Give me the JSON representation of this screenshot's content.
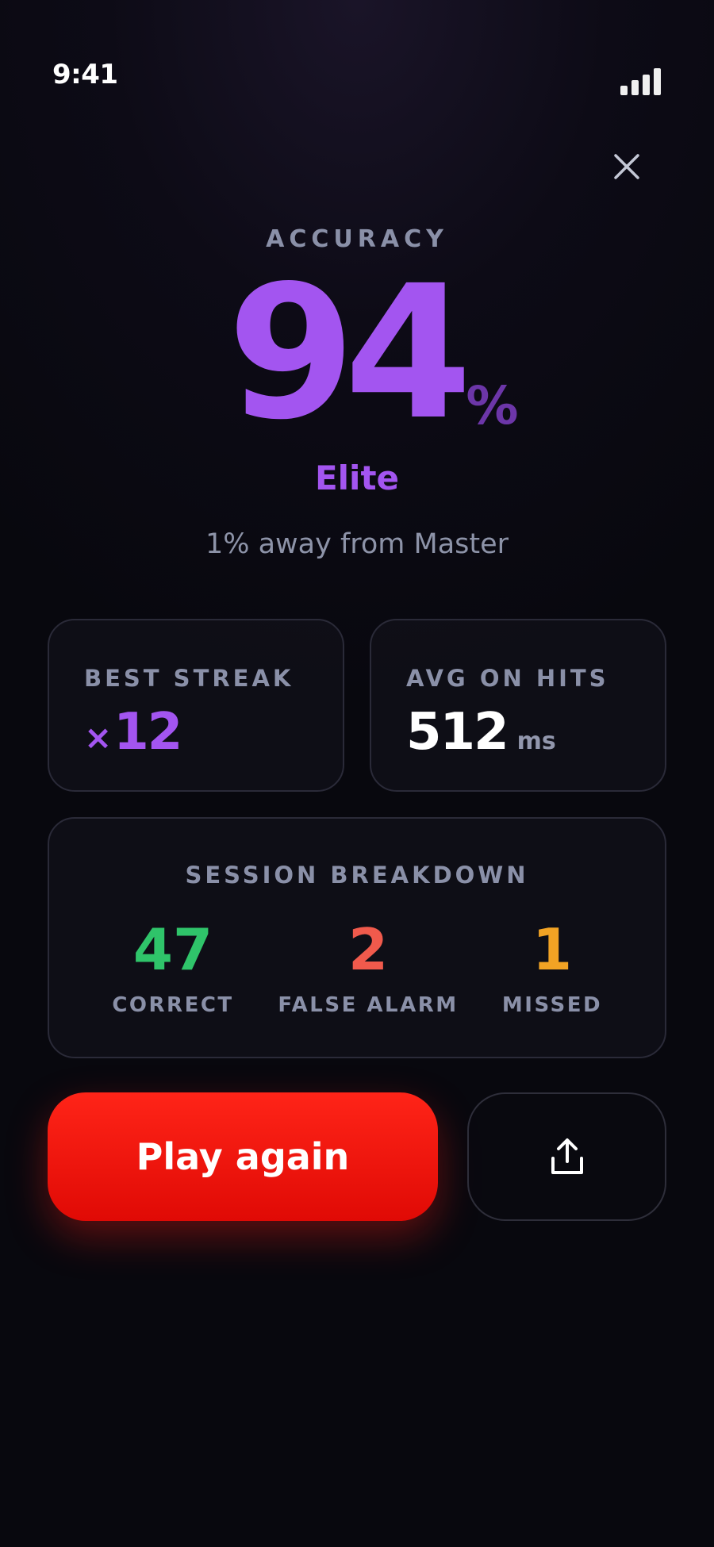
{
  "status_bar": {
    "time": "9:41",
    "signal_icon": "cellular-signal-icon"
  },
  "header": {
    "close_icon": "close-icon"
  },
  "score": {
    "label": "ACCURACY",
    "value": "94",
    "unit": "%",
    "tier": "Elite",
    "next_tier_text": "1% away from Master"
  },
  "stats": {
    "best_streak": {
      "label": "BEST STREAK",
      "prefix": "×",
      "value": "12"
    },
    "avg_on_hits": {
      "label": "AVG ON HITS",
      "value": "512",
      "unit": "ms"
    }
  },
  "breakdown": {
    "title": "SESSION BREAKDOWN",
    "items": [
      {
        "value": "47",
        "label": "CORRECT",
        "color": "#2fc46a"
      },
      {
        "value": "2",
        "label": "FALSE ALARM",
        "color": "#f05a4c"
      },
      {
        "value": "1",
        "label": "MISSED",
        "color": "#f2a324"
      }
    ]
  },
  "actions": {
    "play_again_label": "Play again",
    "share_icon": "share-icon"
  },
  "colors": {
    "accent_purple": "#a355f0",
    "accent_red": "#ff1e14",
    "muted_text": "#8a90a8"
  }
}
